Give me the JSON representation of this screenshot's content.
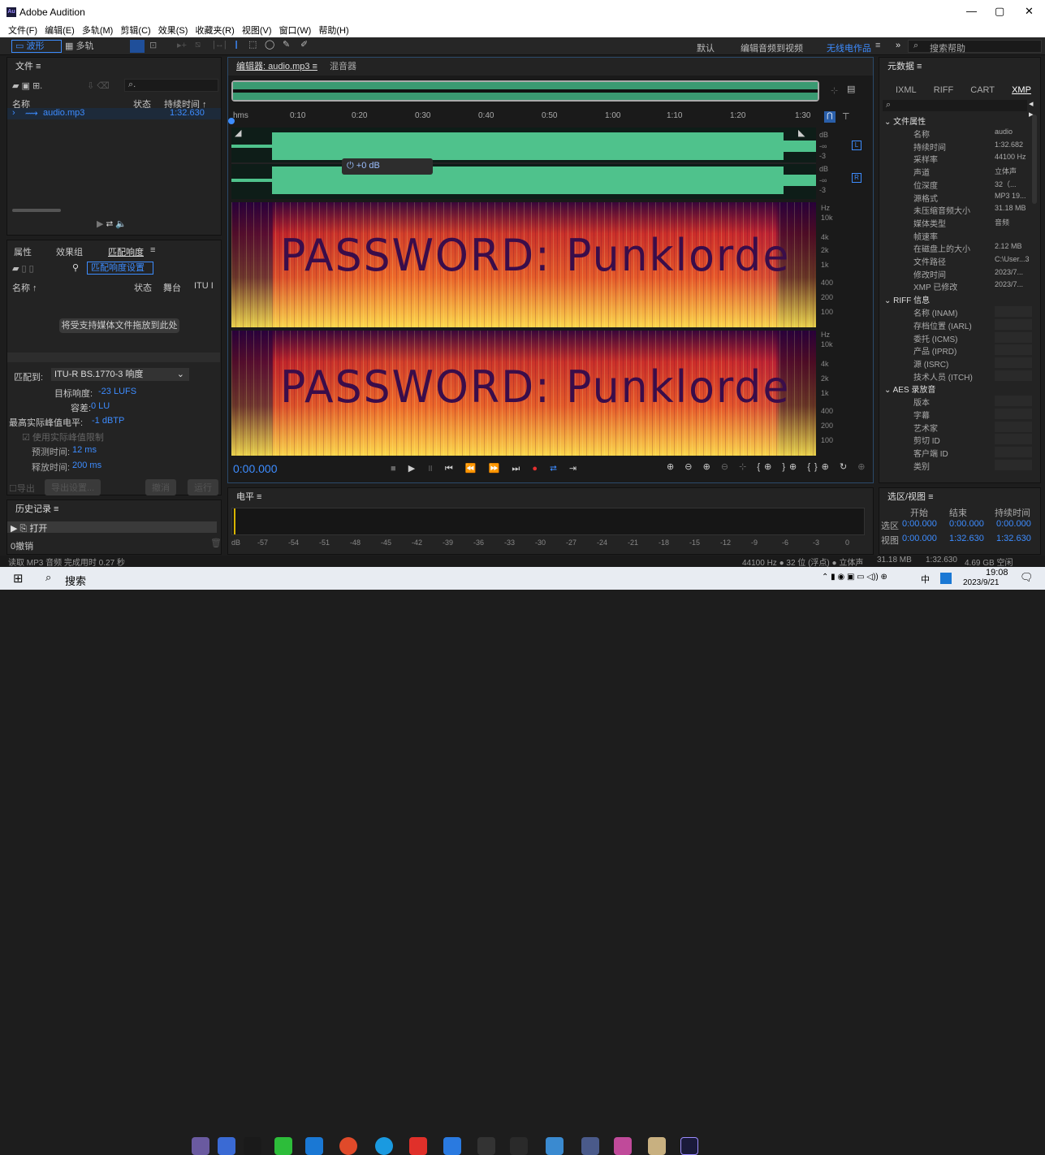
{
  "window": {
    "title": "Adobe Audition",
    "minimize": "—",
    "maximize": "▢",
    "close": "✕"
  },
  "menu": [
    "文件(F)",
    "编辑(E)",
    "多轨(M)",
    "剪辑(C)",
    "效果(S)",
    "收藏夹(R)",
    "视图(V)",
    "窗口(W)",
    "帮助(H)"
  ],
  "toolbar": {
    "waveform": "波形",
    "multitrack": "多轨",
    "default": "默认",
    "edit_to_video": "编辑音频到视频",
    "radio": "无线电作品",
    "more": "»",
    "search_placeholder": "搜索帮助"
  },
  "files_panel": {
    "title": "文件",
    "col_name": "名称",
    "col_status": "状态",
    "col_duration": "持续时间",
    "file": "audio.mp3",
    "file_duration": "1:32.630"
  },
  "props_panel": {
    "tabs": [
      "属性",
      "效果组",
      "匹配响度"
    ],
    "settings_btn": "匹配响度设置",
    "col_name": "名称",
    "col_status": "状态",
    "col_stage": "舞台",
    "col_itu": "ITU I",
    "drop_text": "将受支持媒体文件拖放到此处",
    "match_to_label": "匹配到:",
    "match_to_value": "ITU-R BS.1770-3 响度",
    "target_label": "目标响度:",
    "target_value": "-23 LUFS",
    "tolerance_label": "容差:",
    "tolerance_value": "0 LU",
    "peak_label": "最高实际峰值电平:",
    "peak_value": "-1 dBTP",
    "limit_label": "使用实际峰值限制",
    "lookahead_label": "预测时间:",
    "lookahead_value": "12 ms",
    "release_label": "释放时间:",
    "release_value": "200 ms",
    "export": "导出",
    "export_settings": "导出设置...",
    "cancel": "撤消",
    "run": "运行"
  },
  "history": {
    "title": "历史记录",
    "item": "打开",
    "undo": "0撤销"
  },
  "editor": {
    "tab": "编辑器: audio.mp3",
    "mixer": "混音器",
    "timecode": "0:00.000",
    "volume": "+0 dB",
    "ruler": [
      "hms",
      "0:10",
      "0:20",
      "0:30",
      "0:40",
      "0:50",
      "1:00",
      "1:10",
      "1:20",
      "1:30"
    ],
    "db": [
      "dB",
      "-∞",
      "-3",
      "dB",
      "-∞",
      "-3"
    ],
    "ch_l": "L",
    "ch_r": "R",
    "hz": [
      "Hz",
      "10k",
      "4k",
      "2k",
      "1k",
      "400",
      "200",
      "100"
    ],
    "spectral_text": "PASSWORD: Punklorde"
  },
  "level_meter": {
    "title": "电平",
    "scale": [
      "dB",
      "-57",
      "-54",
      "-51",
      "-48",
      "-45",
      "-42",
      "-39",
      "-36",
      "-33",
      "-30",
      "-27",
      "-24",
      "-21",
      "-18",
      "-15",
      "-12",
      "-9",
      "-6",
      "-3",
      "0"
    ]
  },
  "metadata": {
    "title": "元数据",
    "tabs": [
      "IXML",
      "RIFF",
      "CART",
      "XMP"
    ],
    "sections": [
      {
        "title": "文件属性",
        "rows": [
          [
            "名称",
            "audio"
          ],
          [
            "持续时间",
            "1:32.682"
          ],
          [
            "采样率",
            "44100 Hz"
          ],
          [
            "声道",
            "立体声"
          ],
          [
            "位深度",
            "32（..."
          ],
          [
            "源格式",
            "MP3 19..."
          ],
          [
            "未压缩音频大小",
            "31.18 MB"
          ],
          [
            "媒体类型",
            "音频"
          ],
          [
            "帧速率",
            ""
          ],
          [
            "在磁盘上的大小",
            "2.12 MB"
          ],
          [
            "文件路径",
            "C:\\User...3"
          ],
          [
            "修改时间",
            "2023/7..."
          ],
          [
            "XMP 已修改",
            "2023/7..."
          ]
        ]
      },
      {
        "title": "RIFF 信息",
        "rows": [
          [
            "名称 (INAM)",
            ""
          ],
          [
            "存档位置 (IARL)",
            ""
          ],
          [
            "委托 (ICMS)",
            ""
          ],
          [
            "产品 (IPRD)",
            ""
          ],
          [
            "源 (ISRC)",
            ""
          ],
          [
            "技术人员 (ITCH)",
            ""
          ]
        ]
      },
      {
        "title": "AES 录放音",
        "rows": [
          [
            "版本",
            ""
          ],
          [
            "字幕",
            ""
          ],
          [
            "艺术家",
            ""
          ],
          [
            "剪切 ID",
            ""
          ],
          [
            "客户端 ID",
            ""
          ],
          [
            "类别",
            ""
          ]
        ]
      }
    ]
  },
  "selection": {
    "title": "选区/视图",
    "headers": [
      "开始",
      "结束",
      "持续时间"
    ],
    "sel_label": "选区",
    "sel": [
      "0:00.000",
      "0:00.000",
      "0:00.000"
    ],
    "view_label": "视图",
    "view": [
      "0:00.000",
      "1:32.630",
      "1:32.630"
    ]
  },
  "status": {
    "left": "读取 MP3 音频 完成用时 0.27 秒",
    "format": "44100 Hz ● 32 位 (浮点) ● 立体声",
    "size": "31.18 MB",
    "duration": "1:32.630",
    "free": "4.69 GB 空闲"
  },
  "taskbar": {
    "search": "搜索",
    "time": "19:08",
    "date": "2023/9/21",
    "ime": "中"
  }
}
